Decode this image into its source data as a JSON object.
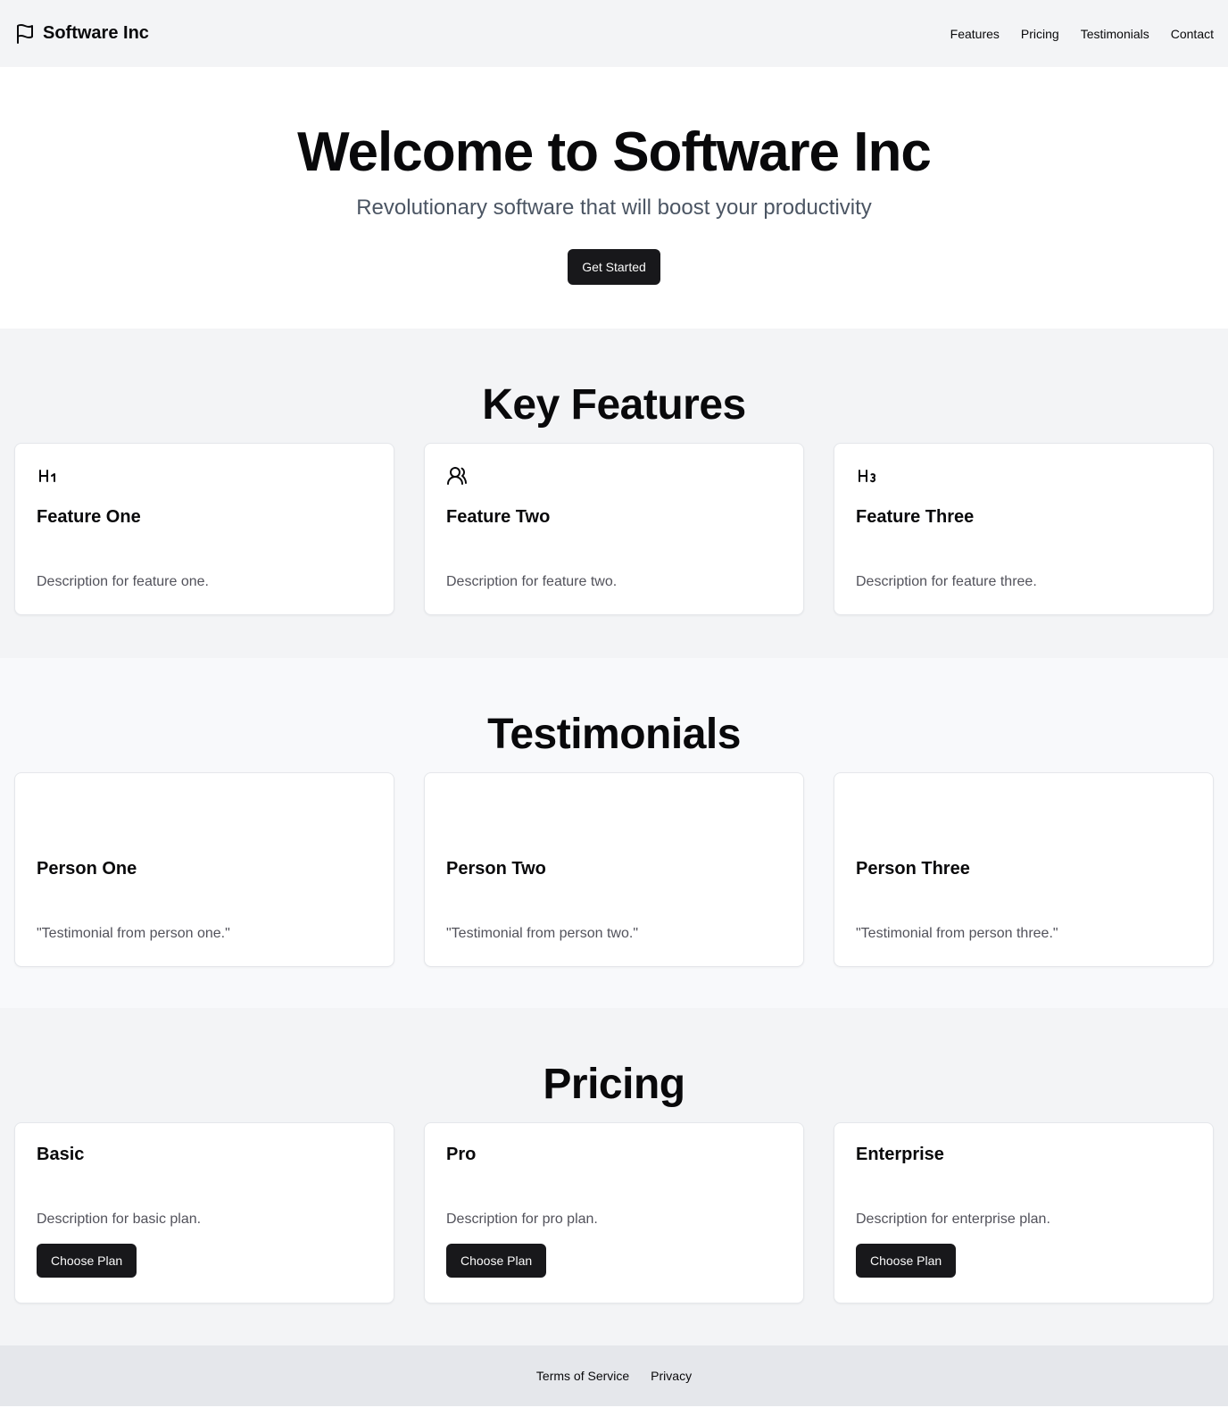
{
  "header": {
    "brand": "Software Inc",
    "brand_icon": "flag-icon",
    "nav": [
      "Features",
      "Pricing",
      "Testimonials",
      "Contact"
    ]
  },
  "hero": {
    "title": "Welcome to Software Inc",
    "subtitle": "Revolutionary software that will boost your productivity",
    "cta": "Get Started"
  },
  "features": {
    "title": "Key Features",
    "items": [
      {
        "icon": "heading-1-icon",
        "icon_text": "H1",
        "title": "Feature One",
        "description": "Description for feature one."
      },
      {
        "icon": "users-icon",
        "icon_text": "",
        "title": "Feature Two",
        "description": "Description for feature two."
      },
      {
        "icon": "heading-3-icon",
        "icon_text": "H3",
        "title": "Feature Three",
        "description": "Description for feature three."
      }
    ]
  },
  "testimonials": {
    "title": "Testimonials",
    "items": [
      {
        "name": "Person One",
        "quote": "\"Testimonial from person one.\""
      },
      {
        "name": "Person Two",
        "quote": "\"Testimonial from person two.\""
      },
      {
        "name": "Person Three",
        "quote": "\"Testimonial from person three.\""
      }
    ]
  },
  "pricing": {
    "title": "Pricing",
    "plans": [
      {
        "name": "Basic",
        "description": "Description for basic plan.",
        "cta": "Choose Plan"
      },
      {
        "name": "Pro",
        "description": "Description for pro plan.",
        "cta": "Choose Plan"
      },
      {
        "name": "Enterprise",
        "description": "Description for enterprise plan.",
        "cta": "Choose Plan"
      }
    ]
  },
  "footer": {
    "links": [
      "Terms of Service",
      "Privacy"
    ]
  },
  "colors": {
    "primary_button": "#18181b",
    "header_bg": "#f3f4f6",
    "footer_bg": "#e5e7eb",
    "muted_text": "#52525b"
  }
}
